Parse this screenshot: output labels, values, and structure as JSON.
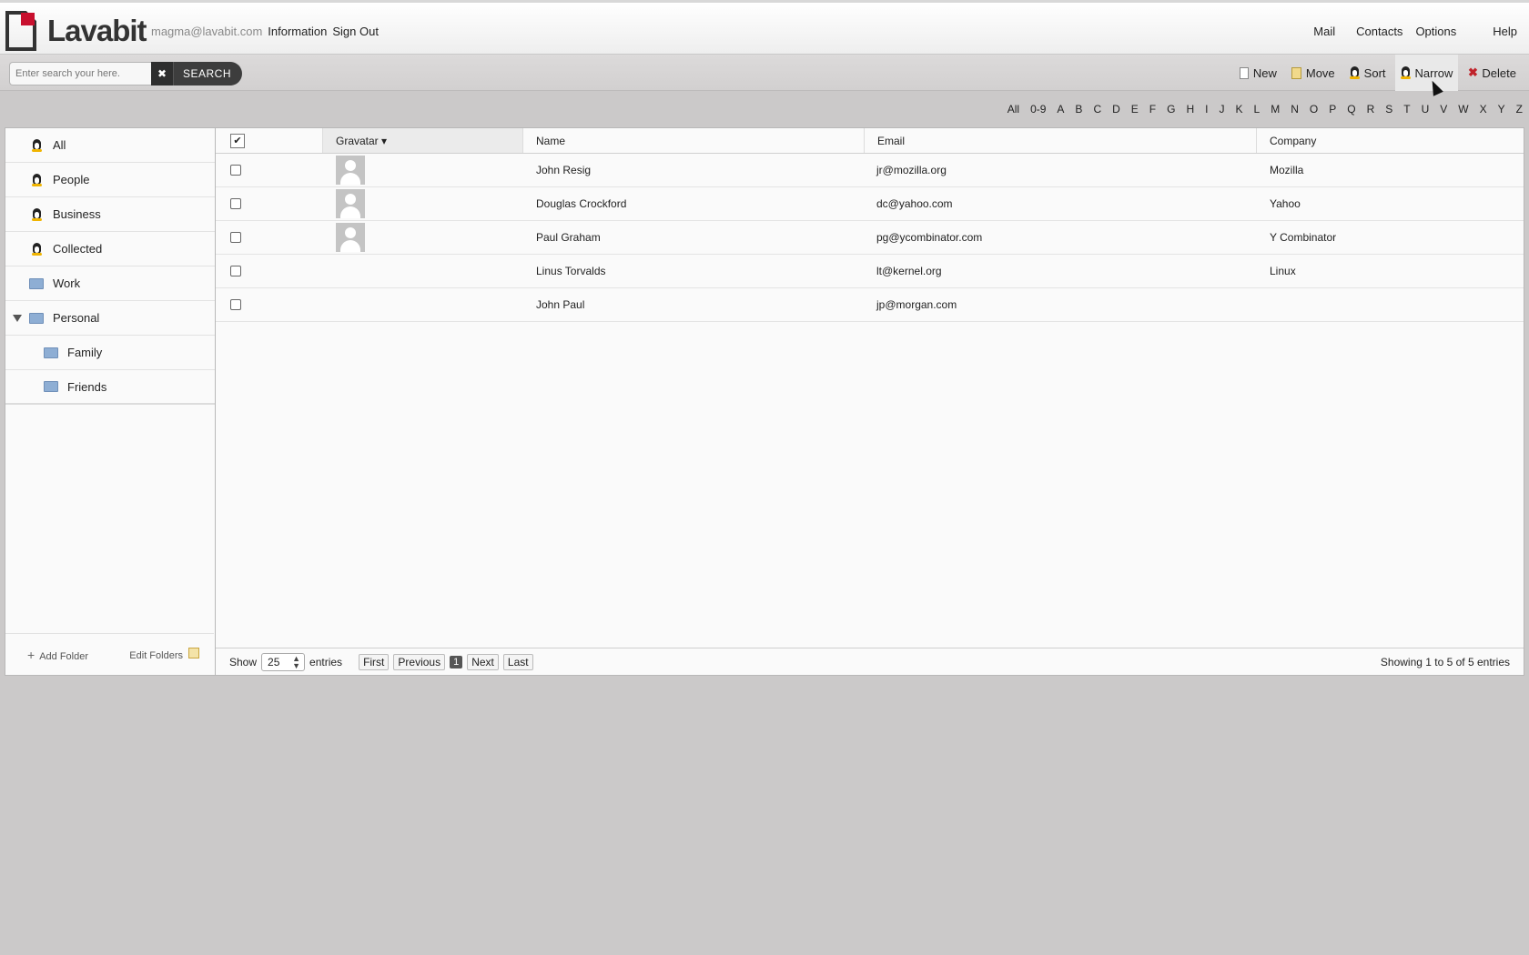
{
  "app": {
    "name": "Lavabit"
  },
  "account": {
    "email": "magma@lavabit.com",
    "information": "Information",
    "signout": "Sign Out"
  },
  "nav": {
    "mail": "Mail",
    "contacts": "Contacts",
    "options": "Options",
    "help": "Help"
  },
  "search": {
    "placeholder": "Enter search your here.",
    "clear": "✖",
    "button": "SEARCH"
  },
  "actions": {
    "new": "New",
    "move": "Move",
    "sort": "Sort",
    "narrow": "Narrow",
    "delete": "Delete"
  },
  "letters": [
    "All",
    "0-9",
    "A",
    "B",
    "C",
    "D",
    "E",
    "F",
    "G",
    "H",
    "I",
    "J",
    "K",
    "L",
    "M",
    "N",
    "O",
    "P",
    "Q",
    "R",
    "S",
    "T",
    "U",
    "V",
    "W",
    "X",
    "Y",
    "Z"
  ],
  "sidebar": {
    "items": [
      {
        "label": "All",
        "icon": "penguin-icon"
      },
      {
        "label": "People",
        "icon": "penguin-icon"
      },
      {
        "label": "Business",
        "icon": "penguin-icon"
      },
      {
        "label": "Collected",
        "icon": "penguin-icon"
      },
      {
        "label": "Work",
        "icon": "folder-icon"
      },
      {
        "label": "Personal",
        "icon": "folder-icon"
      },
      {
        "label": "Family",
        "icon": "folder-icon"
      },
      {
        "label": "Friends",
        "icon": "folder-icon"
      }
    ],
    "add_folder": "Add Folder",
    "edit_folders": "Edit Folders"
  },
  "table": {
    "headers": {
      "check": "✔",
      "gravatar": "Gravatar ▾",
      "name": "Name",
      "email": "Email",
      "company": "Company"
    },
    "rows": [
      {
        "name": "John Resig",
        "email": "jr@mozilla.org",
        "company": "Mozilla",
        "avatar": true
      },
      {
        "name": "Douglas Crockford",
        "email": "dc@yahoo.com",
        "company": "Yahoo",
        "avatar": true
      },
      {
        "name": "Paul Graham",
        "email": "pg@ycombinator.com",
        "company": "Y Combinator",
        "avatar": true
      },
      {
        "name": "Linus Torvalds",
        "email": "lt@kernel.org",
        "company": "Linux",
        "avatar": false
      },
      {
        "name": "John Paul",
        "email": "jp@morgan.com",
        "company": "",
        "avatar": false
      }
    ]
  },
  "footer": {
    "show": "Show",
    "entries_value": "25",
    "entries": "entries",
    "first": "First",
    "previous": "Previous",
    "current_page": "1",
    "next": "Next",
    "last": "Last",
    "showing": "Showing 1 to 5 of 5 entries"
  },
  "colors": {
    "logo_red": "#c8102e",
    "background": "#cbc9c9",
    "panel": "#fafafa"
  }
}
